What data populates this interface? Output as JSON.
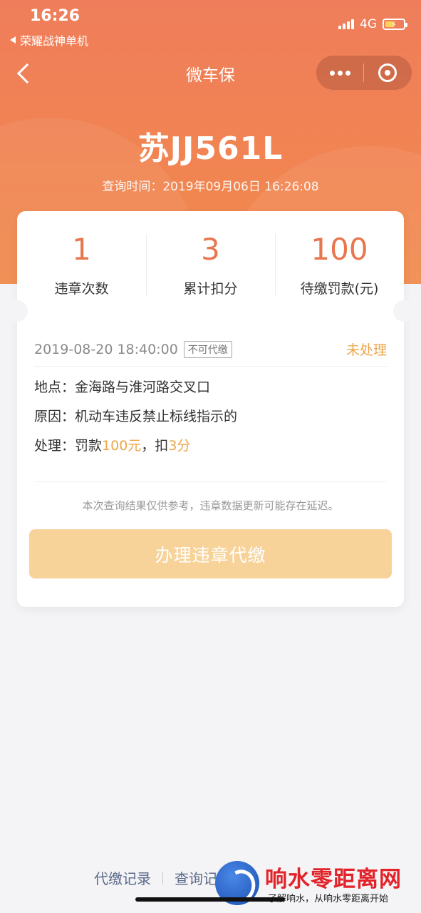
{
  "status_bar": {
    "time": "16:26",
    "back_app": "荣耀战神单机",
    "network": "4G",
    "battery_icon": "battery-charging-icon"
  },
  "nav": {
    "title": "微车保",
    "back_icon": "chevron-left-icon",
    "more_icon": "more-dots-icon",
    "close_icon": "target-close-icon"
  },
  "vehicle": {
    "plate": "苏JJ561L",
    "query_time": "查询时间：2019年09月06日 16:26:08"
  },
  "stats": [
    {
      "value": "1",
      "label": "违章次数"
    },
    {
      "value": "3",
      "label": "累计扣分"
    },
    {
      "value": "100",
      "label": "待缴罚款(元)"
    }
  ],
  "record": {
    "time": "2019-08-20 18:40:00",
    "tag": "不可代缴",
    "status": "未处理",
    "location_label": "地点：",
    "location": "金海路与淮河路交叉口",
    "reason_label": "原因：",
    "reason": "机动车违反禁止标线指示的",
    "handle_label": "处理：",
    "handle_prefix": "罚款",
    "fine": "100元",
    "handle_mid": "，扣",
    "points": "3分"
  },
  "disclaimer": "本次查询结果仅供参考，违章数据更新可能存在延迟。",
  "pay_button": "办理违章代缴",
  "bottom_links": {
    "link1": "代缴记录",
    "link2": "查询记录"
  },
  "watermark": {
    "title": "响水零距离网",
    "subtitle": "了解响水，从响水零距离开始"
  },
  "colors": {
    "header": "#ef7d5b",
    "accent": "#e8764f",
    "highlight": "#eda64a",
    "button": "#f7d39a"
  }
}
